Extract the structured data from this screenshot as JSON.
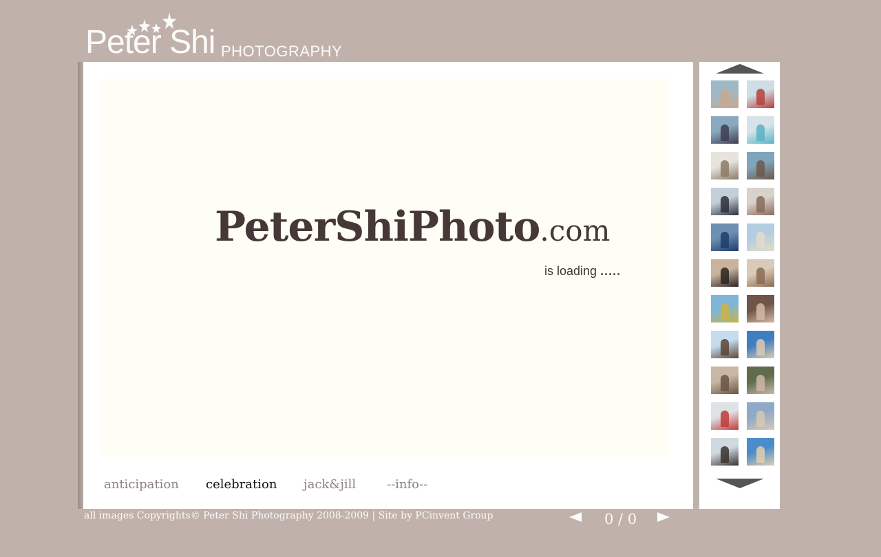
{
  "header": {
    "logo_name": "Peter Shi",
    "logo_sub": "PHOTOGRAPHY"
  },
  "viewer": {
    "brand_main": "PeterShiPhoto",
    "brand_tld": ".com",
    "loading_text": "is loading",
    "loading_dots": "....."
  },
  "galleries": [
    {
      "label": "anticipation",
      "active": false
    },
    {
      "label": "celebration",
      "active": true
    },
    {
      "label": "jack&jill",
      "active": false
    },
    {
      "label": "--info--",
      "active": false
    }
  ],
  "thumbnails": [
    {
      "bg": "#9fb8c6",
      "fg": "#c9a88c"
    },
    {
      "bg": "#cfdde6",
      "fg": "#b5423b"
    },
    {
      "bg": "#8aa9c0",
      "fg": "#3e3e52"
    },
    {
      "bg": "#d7e3e8",
      "fg": "#5ab2c6"
    },
    {
      "bg": "#e6e4dc",
      "fg": "#8c7a66"
    },
    {
      "bg": "#7fa5bd",
      "fg": "#6c5848"
    },
    {
      "bg": "#c2cfd8",
      "fg": "#2f2f3a"
    },
    {
      "bg": "#d8d2cc",
      "fg": "#8a6a58"
    },
    {
      "bg": "#6d90b2",
      "fg": "#1e3c6e"
    },
    {
      "bg": "#b4cde0",
      "fg": "#e3dcc8"
    },
    {
      "bg": "#c9b39d",
      "fg": "#2b2421"
    },
    {
      "bg": "#d9cbb8",
      "fg": "#8b6b52"
    },
    {
      "bg": "#7eb5d7",
      "fg": "#c9b44a"
    },
    {
      "bg": "#6e5548",
      "fg": "#d6b9a4"
    },
    {
      "bg": "#c5dcee",
      "fg": "#5c4436"
    },
    {
      "bg": "#3f7fbf",
      "fg": "#dccab2"
    },
    {
      "bg": "#c7b7a4",
      "fg": "#6a5443"
    },
    {
      "bg": "#5f6c4c",
      "fg": "#cbb8a6"
    },
    {
      "bg": "#dfe2e4",
      "fg": "#c23a3a"
    },
    {
      "bg": "#8fa9c9",
      "fg": "#d7c8b4"
    },
    {
      "bg": "#cfd9e0",
      "fg": "#3a3230"
    },
    {
      "bg": "#4b8dc9",
      "fg": "#e1cfae"
    }
  ],
  "footer": {
    "copyright": "all images Copyrights© Peter Shi Photography 2008-2009 | Site by PCinvent Group",
    "counter": "0 / 0"
  },
  "colors": {
    "page_bg": "#c0b2ab",
    "viewer_bg": "#fffef5",
    "brand_text": "#463837",
    "arrow": "#555555"
  }
}
